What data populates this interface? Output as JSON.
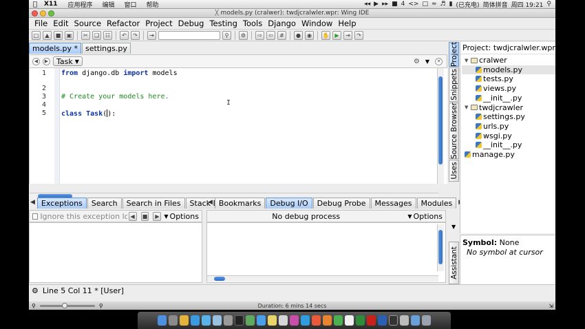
{
  "mac_menubar": {
    "app_name": "X11",
    "menus": [
      "应用程序",
      "编辑",
      "窗口",
      "帮助"
    ],
    "status_items": [
      "◂◂",
      "▶",
      "▸▸",
      "4",
      "(已充电)",
      "简体拼音",
      "周四 19:21"
    ]
  },
  "window": {
    "title": "models.py (cralwer): twdjcralwler.wpr: Wing IDE",
    "menu": [
      "File",
      "Edit",
      "Source",
      "Refactor",
      "Project",
      "Debug",
      "Testing",
      "Tools",
      "Django",
      "Window",
      "Help"
    ]
  },
  "editor": {
    "tabs": [
      {
        "label": "models.py *",
        "active": true
      },
      {
        "label": "settings.py",
        "active": false
      }
    ],
    "scope_dropdown": "Task",
    "line_numbers": [
      "1",
      "2",
      "3",
      "4",
      "5"
    ],
    "code": {
      "l1_kw1": "from",
      "l1_mod": " django.db ",
      "l1_kw2": "import",
      "l1_name": " models",
      "l3_comment": "# Create your models here.",
      "l5_kw": "class",
      "l5_name": "Task",
      "l5_open": "(",
      "l5_close": "):"
    },
    "ibeam": "I"
  },
  "left_panel": {
    "tabs": [
      {
        "label": "Exceptions",
        "active": true
      },
      {
        "label": "Search",
        "active": false
      },
      {
        "label": "Search in Files",
        "active": false
      },
      {
        "label": "Stack Data",
        "active": false
      }
    ],
    "ignore_checkbox_label": "Ignore this exception loca",
    "options_label": "Options"
  },
  "debug_panel": {
    "tabs": [
      {
        "label": "Bookmarks",
        "active": false
      },
      {
        "label": "Debug I/O",
        "active": true
      },
      {
        "label": "Debug Probe",
        "active": false
      },
      {
        "label": "Messages",
        "active": false
      },
      {
        "label": "Modules",
        "active": false
      }
    ],
    "process_status": "No debug process",
    "options_label": "Options"
  },
  "side_tabs": [
    "Project",
    "Snippets",
    "Source Browser",
    "Uses"
  ],
  "assistant_tab": "Assistant",
  "project": {
    "title": "Project: twdjcralwler.wpr [",
    "tree": [
      {
        "label": "cralwer",
        "type": "folder",
        "indent": 0
      },
      {
        "label": "models.py",
        "type": "py",
        "indent": 1,
        "selected": true
      },
      {
        "label": "tests.py",
        "type": "py",
        "indent": 1
      },
      {
        "label": "views.py",
        "type": "py",
        "indent": 1
      },
      {
        "label": "__init__.py",
        "type": "py",
        "indent": 1
      },
      {
        "label": "twdjcrawler",
        "type": "folder",
        "indent": 0
      },
      {
        "label": "settings.py",
        "type": "py",
        "indent": 1
      },
      {
        "label": "urls.py",
        "type": "py",
        "indent": 1
      },
      {
        "label": "wsgi.py",
        "type": "py",
        "indent": 1
      },
      {
        "label": "__init__.py",
        "type": "py",
        "indent": 1
      },
      {
        "label": "manage.py",
        "type": "py",
        "indent": 0
      }
    ]
  },
  "symbol": {
    "label": "Symbol:",
    "value": "None",
    "note": "No symbol at cursor"
  },
  "status_bar": {
    "text": "Line 5 Col 11 * [User]"
  },
  "video_bar": {
    "duration": "Duration: 6 mins 14 secs",
    "progress": 0.4
  },
  "colors": {
    "accent_tab": "#a9cbf6",
    "keyword": "#0b31a0",
    "comment": "#1c8a1c",
    "scroll_thumb": "#2f6fc6"
  }
}
